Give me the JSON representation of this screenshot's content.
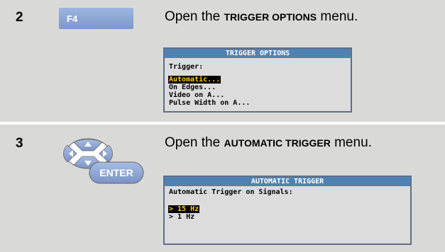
{
  "steps": [
    {
      "number": "2",
      "key_label": "F4",
      "instruction_prefix": "Open the ",
      "instruction_menu": "TRIGGER OPTIONS",
      "instruction_suffix": " menu.",
      "screen": {
        "title": "TRIGGER OPTIONS",
        "lines": [
          "Trigger:",
          "Automatic...",
          "On Edges...",
          "Video on A...",
          "Pulse Width on A..."
        ],
        "selected": "Automatic..."
      }
    },
    {
      "number": "3",
      "key_label": "ENTER",
      "instruction_prefix": "Open the ",
      "instruction_menu": "AUTOMATIC TRIGGER",
      "instruction_suffix": " menu.",
      "screen": {
        "title": "AUTOMATIC TRIGGER",
        "lines": [
          "Automatic Trigger on Signals:",
          "> 15 Hz",
          "> 1 Hz"
        ],
        "selected": "> 15 Hz"
      }
    }
  ],
  "colors": {
    "panel_bg": "#d9dad7",
    "fkey_blue": "#8aa6d6",
    "screen_title_bg": "#4f82b3",
    "highlight_text": "#ffcc00",
    "nav_key_blue": "#8ea7d4"
  },
  "icons": [
    "f4-softkey-icon",
    "arrow-keys-enter-icon"
  ]
}
